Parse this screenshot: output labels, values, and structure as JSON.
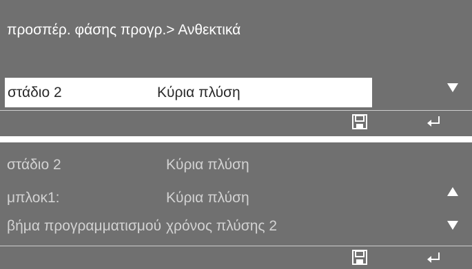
{
  "top_panel": {
    "header": "προσπέρ. φάσης προγρ.> Ανθεκτικά",
    "selected_row": {
      "label": "στάδιο 2",
      "value": "Κύρια πλύση"
    }
  },
  "bottom_panel": {
    "rows": [
      {
        "label": "στάδιο 2",
        "value": "Κύρια πλύση"
      },
      {
        "label": "μπλοκ1:",
        "value": "Κύρια πλύση"
      },
      {
        "label": "βήμα προγραμματισμού",
        "value": "χρόνος πλύσης 2"
      }
    ]
  },
  "icons": {
    "down": "triangle-down-icon",
    "up": "triangle-up-icon",
    "save": "floppy-disk-icon",
    "back": "return-arrow-icon"
  },
  "colors": {
    "panel_bg": "#707070",
    "text": "#ffffff",
    "selection_bg": "#ffffff",
    "selection_text": "#2a2a2a"
  }
}
